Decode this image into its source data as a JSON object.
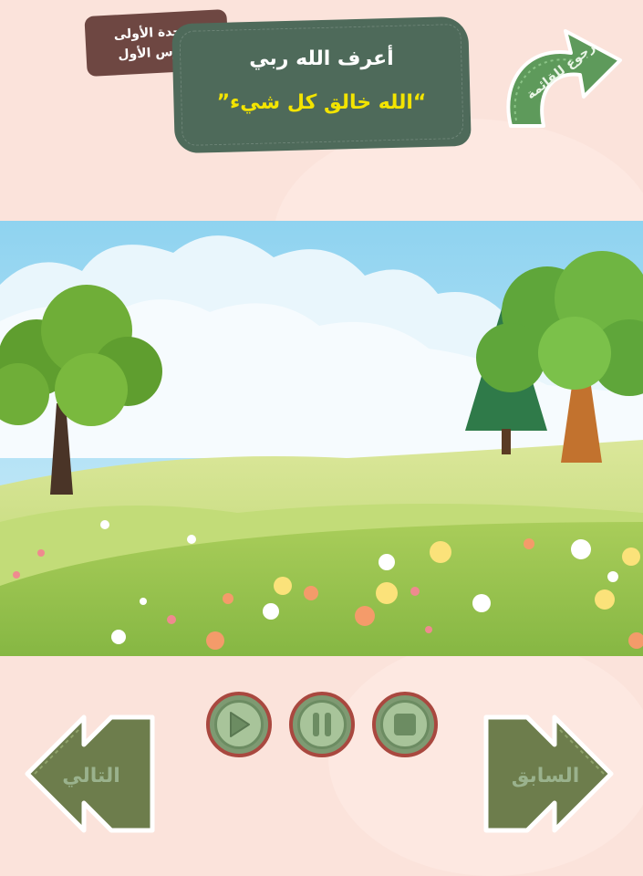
{
  "header": {
    "unit": "الوحدة الأولى",
    "lesson": "الدرس الأول",
    "title": "أعرف الله ربي",
    "subtitle": "“الله خالق كل شيء”",
    "back_label": "رجوع للقائمة"
  },
  "controls": {
    "play_icon": "play-icon",
    "pause_icon": "pause-icon",
    "stop_icon": "stop-icon"
  },
  "navigation": {
    "next_label": "التالي",
    "previous_label": "السابق"
  },
  "colors": {
    "background": "#fbe3db",
    "board": "#4e6a5a",
    "badge": "#6e4742",
    "subtitle": "#f3e400",
    "button_green": "#7e9a72",
    "button_border": "#a9483f"
  }
}
